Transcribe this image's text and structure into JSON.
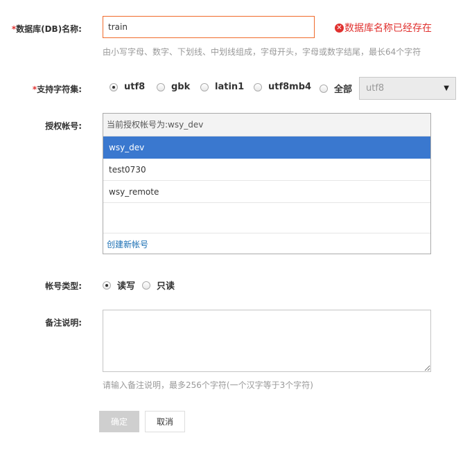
{
  "dbname": {
    "required_mark": "*",
    "label": "数据库(DB)名称:",
    "value": "train",
    "error": "数据库名称已经存在",
    "hint": "由小写字母、数字、下划线、中划线组成，字母开头，字母或数字结尾，最长64个字符"
  },
  "charset": {
    "required_mark": "*",
    "label": "支持字符集:",
    "options": [
      {
        "label": "utf8",
        "checked": true
      },
      {
        "label": "gbk",
        "checked": false
      },
      {
        "label": "latin1",
        "checked": false
      },
      {
        "label": "utf8mb4",
        "checked": false
      },
      {
        "label": "全部",
        "checked": false
      }
    ],
    "select_value": "utf8"
  },
  "account": {
    "label": "授权帐号:",
    "header": "当前授权帐号为:wsy_dev",
    "items": [
      {
        "name": "wsy_dev",
        "selected": true
      },
      {
        "name": "test0730",
        "selected": false
      },
      {
        "name": "wsy_remote",
        "selected": false
      }
    ],
    "create_link": "创建新帐号"
  },
  "account_type": {
    "label": "帐号类型:",
    "options": [
      {
        "label": "读写",
        "checked": true
      },
      {
        "label": "只读",
        "checked": false
      }
    ]
  },
  "remark": {
    "label": "备注说明:",
    "value": "",
    "hint": "请输入备注说明，最多256个字符(一个汉字等于3个字符)"
  },
  "buttons": {
    "ok": "确定",
    "cancel": "取消"
  }
}
